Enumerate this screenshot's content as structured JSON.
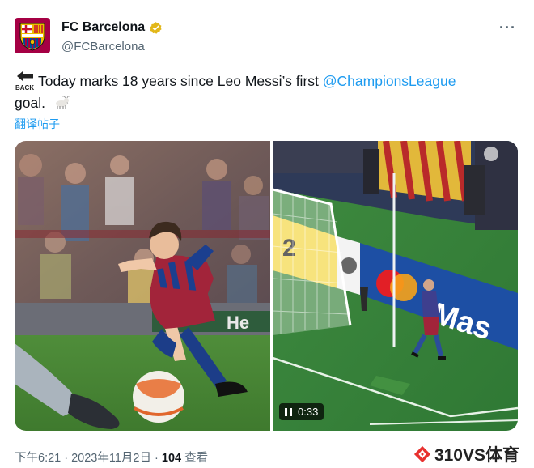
{
  "author": {
    "name": "FC Barcelona",
    "handle": "@FCBarcelona",
    "more_label": "···"
  },
  "tweet": {
    "emoji": "back-arrow-emoji",
    "text_before": "Today marks 18 years since Leo Messi’s first ",
    "mention": "@ChampionsLeague",
    "text_after": "goal.",
    "goat_emoji": "goat-emoji",
    "translate_label": "翻译帖子"
  },
  "media": {
    "video_time": "0:33",
    "ad_left": "2",
    "ad_right": "Mas"
  },
  "meta": {
    "timestamp": "下午6:21 · 2023年11月2日 · ",
    "views_count": "104",
    "views_label": " 查看"
  },
  "watermark": {
    "text": "310VS体育"
  },
  "colors": {
    "link": "#1d9bf0",
    "secondary": "#536471",
    "barca_blue": "#004d98",
    "barca_red": "#a50044"
  }
}
